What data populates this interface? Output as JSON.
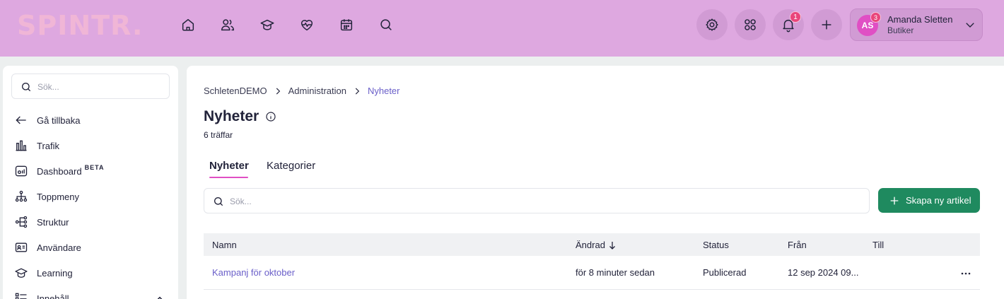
{
  "topbar": {
    "logo": "SPINTR.",
    "nav_icons": [
      "home-icon",
      "people-icon",
      "graduation-cap-icon",
      "heart-pulse-icon",
      "calendar-icon",
      "search-icon"
    ],
    "notifications_count": "1",
    "user": {
      "initials": "AS",
      "badge_count": "3",
      "name": "Amanda Sletten",
      "role": "Butiker"
    }
  },
  "sidebar": {
    "search_placeholder": "Sök...",
    "items": [
      {
        "label": "Gå tillbaka",
        "icon": "arrow-left-icon"
      },
      {
        "label": "Trafik",
        "icon": "bar-chart-icon"
      },
      {
        "label": "Dashboard",
        "icon": "dashboard-icon",
        "badge": "BETA"
      },
      {
        "label": "Toppmeny",
        "icon": "hierarchy-icon"
      },
      {
        "label": "Struktur",
        "icon": "structure-icon"
      },
      {
        "label": "Användare",
        "icon": "id-card-icon"
      },
      {
        "label": "Learning",
        "icon": "graduation-cap-icon"
      },
      {
        "label": "Innehåll",
        "icon": "list-icon"
      }
    ]
  },
  "main": {
    "breadcrumb": [
      "SchletenDEMO",
      "Administration",
      "Nyheter"
    ],
    "title": "Nyheter",
    "hits": "6 träffar",
    "tabs": [
      {
        "label": "Nyheter",
        "active": true
      },
      {
        "label": "Kategorier",
        "active": false
      }
    ],
    "search_placeholder": "Sök...",
    "create_button": "Skapa ny artikel",
    "table": {
      "columns": [
        "Namn",
        "Ändrad",
        "Status",
        "Från",
        "Till"
      ],
      "sorted_column": "Ändrad",
      "rows": [
        {
          "name": "Kampanj för oktober",
          "changed": "för 8 minuter sedan",
          "status": "Publicerad",
          "from": "12 sep 2024 09...",
          "to": ""
        }
      ]
    }
  },
  "colors": {
    "topbar": "#dea8e0",
    "accent": "#6a5fc9",
    "primary_button": "#1f8a5f",
    "tab_underline": "#e04fc4",
    "badge": "#e9457a"
  }
}
